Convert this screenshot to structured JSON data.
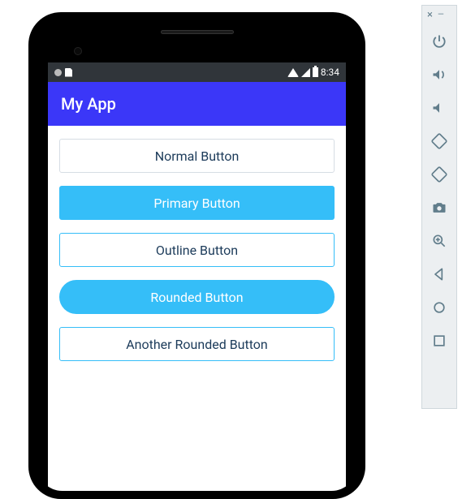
{
  "status_bar": {
    "time": "8:34"
  },
  "app": {
    "title": "My App"
  },
  "buttons": {
    "normal": "Normal Button",
    "primary": "Primary Button",
    "outline": "Outline Button",
    "rounded": "Rounded Button",
    "another_rounded": "Another Rounded Button"
  },
  "toolbar": {
    "close": "×",
    "minimize": "—"
  }
}
